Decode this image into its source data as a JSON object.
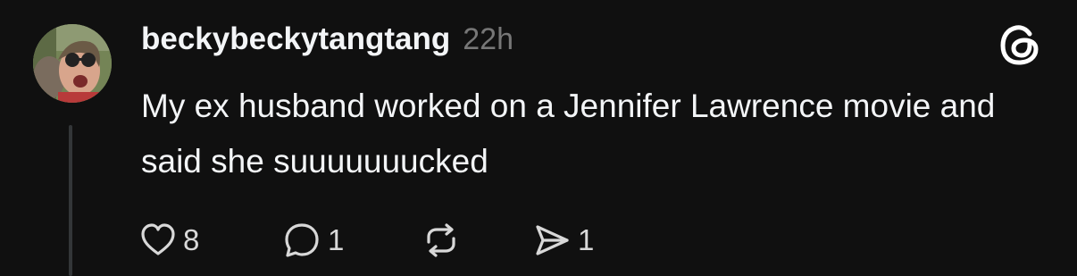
{
  "post": {
    "username": "beckybeckytangtang",
    "timestamp": "22h",
    "text": "My ex husband worked on a Jennifer Lawrence movie and said she suuuuuuucked",
    "actions": {
      "like_count": "8",
      "reply_count": "1",
      "share_count": "1"
    }
  },
  "icons": {
    "app_logo": "threads-logo-icon",
    "like": "heart-icon",
    "reply": "speech-bubble-icon",
    "repost": "repost-arrows-icon",
    "share": "send-arrow-icon"
  },
  "colors": {
    "background": "#101010",
    "text_primary": "#f3f5f7",
    "text_secondary": "#777777",
    "thread_line": "#333638"
  }
}
